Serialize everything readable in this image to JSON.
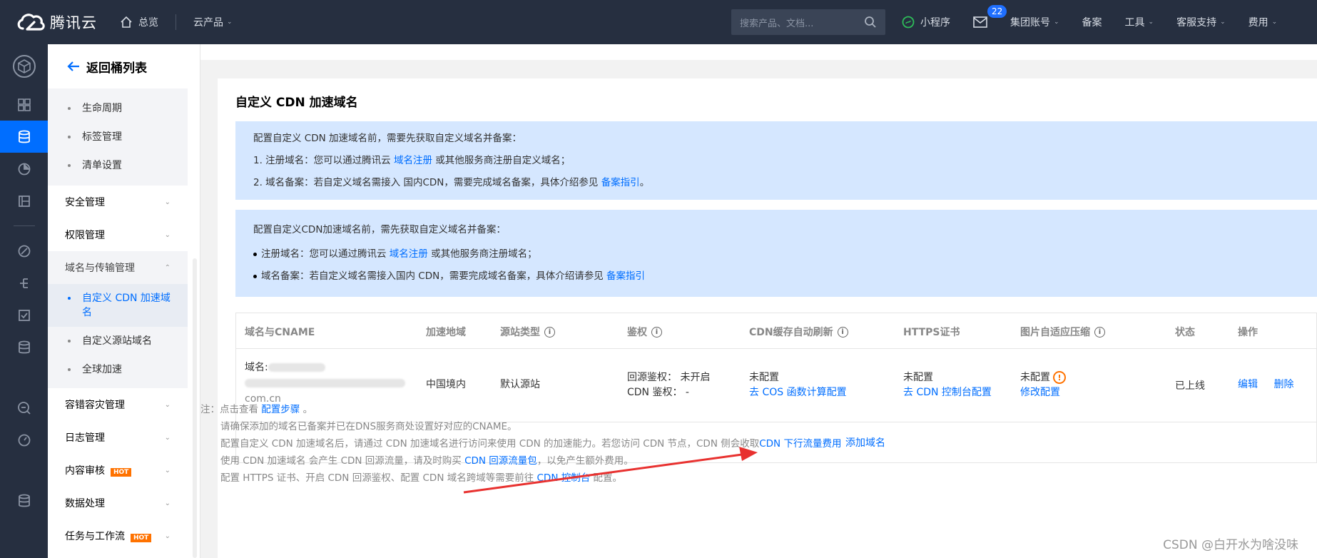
{
  "topbar": {
    "brand": "腾讯云",
    "home": "总览",
    "products": "云产品",
    "search_placeholder": "搜索产品、文档...",
    "mini_program": "小程序",
    "mail_count": "22",
    "account": "集团账号",
    "beian": "备案",
    "tools": "工具",
    "support": "客服支持",
    "billing": "费用"
  },
  "subnav": {
    "back": "返回桶列表",
    "group1": [
      "生命周期",
      "标签管理",
      "清单设置"
    ],
    "security": "安全管理",
    "permission": "权限管理",
    "domain_transfer": "域名与传输管理",
    "group2": [
      "自定义 CDN 加速域名",
      "自定义源站域名",
      "全球加速"
    ],
    "disaster": "容错容灾管理",
    "log": "日志管理",
    "content_review": "内容审核",
    "hot": "HOT",
    "data_processing": "数据处理",
    "workflow": "任务与工作流"
  },
  "page": {
    "title": "自定义 CDN 加速域名",
    "notice1": {
      "head": "配置自定义 CDN 加速域名前，需要先获取自定义域名并备案：",
      "l1_pre": "1. 注册域名：您可以通过腾讯云 ",
      "l1_link": "域名注册",
      "l1_post": " 或其他服务商注册自定义域名；",
      "l2_pre": "2. 域名备案：若自定义域名需接入 国内CDN，需要完成域名备案，具体介绍参见 ",
      "l2_link": "备案指引",
      "l2_post": "。"
    },
    "notice2": {
      "head": "配置自定义CDN加速域名前，需先获取自定义域名并备案：",
      "l1_pre": "注册域名：您可以通过腾讯云 ",
      "l1_link": "域名注册",
      "l1_post": " 或其他服务商注册域名；",
      "l2_pre": "域名备案：若自定义域名需接入国内 CDN，需要完成域名备案，具体介绍请参见 ",
      "l2_link": "备案指引"
    },
    "table": {
      "headers": [
        "域名与CNAME",
        "加速地域",
        "源站类型",
        "鉴权",
        "CDN缓存自动刷新",
        "HTTPS证书",
        "图片自适应压缩",
        "状态",
        "操作"
      ],
      "row": {
        "domain_label": "域名:",
        "domain_tail": "com.cn",
        "region": "中国境内",
        "origin_type": "默认源站",
        "auth1": "回源鉴权：  未开启",
        "auth2": "CDN 鉴权：  -",
        "cache_status": "未配置",
        "cache_link": "去 COS 函数计算配置",
        "https_status": "未配置",
        "https_link": "去 CDN 控制台配置",
        "img_status": "未配置",
        "img_link": "修改配置",
        "state": "已上线",
        "edit": "编辑",
        "delete": "删除"
      },
      "add": "添加域名"
    },
    "notes": {
      "n0_pre": "注：点击查看 ",
      "n0_link": "配置步骤",
      "n0_post": " 。",
      "n1": "请确保添加的域名已备案并已在DNS服务商处设置好对应的CNAME。",
      "n2_pre": "配置自定义 CDN 加速域名后，请通过 CDN 加速域名进行访问来使用 CDN 的加速能力。若您访问 CDN 节点，CDN 侧会收取",
      "n2_link": "CDN 下行流量费用",
      "n3_pre": "使用 CDN 加速域名 会产生 CDN 回源流量，请及时购买 ",
      "n3_link": "CDN 回源流量包",
      "n3_post": "，以免产生额外费用。",
      "n4_pre": "配置 HTTPS 证书、开启 CDN 回源鉴权、配置 CDN 域名跨域等需要前往 ",
      "n4_link": "CDN 控制台",
      "n4_post": " 配置。"
    }
  },
  "watermark": "CSDN @白开水为啥没味",
  "colors": {
    "topbar": "#262f40",
    "accent": "#006eff",
    "notice": "#d5e7ff",
    "hot": "#ff7200",
    "arrow": "#e8312f"
  }
}
